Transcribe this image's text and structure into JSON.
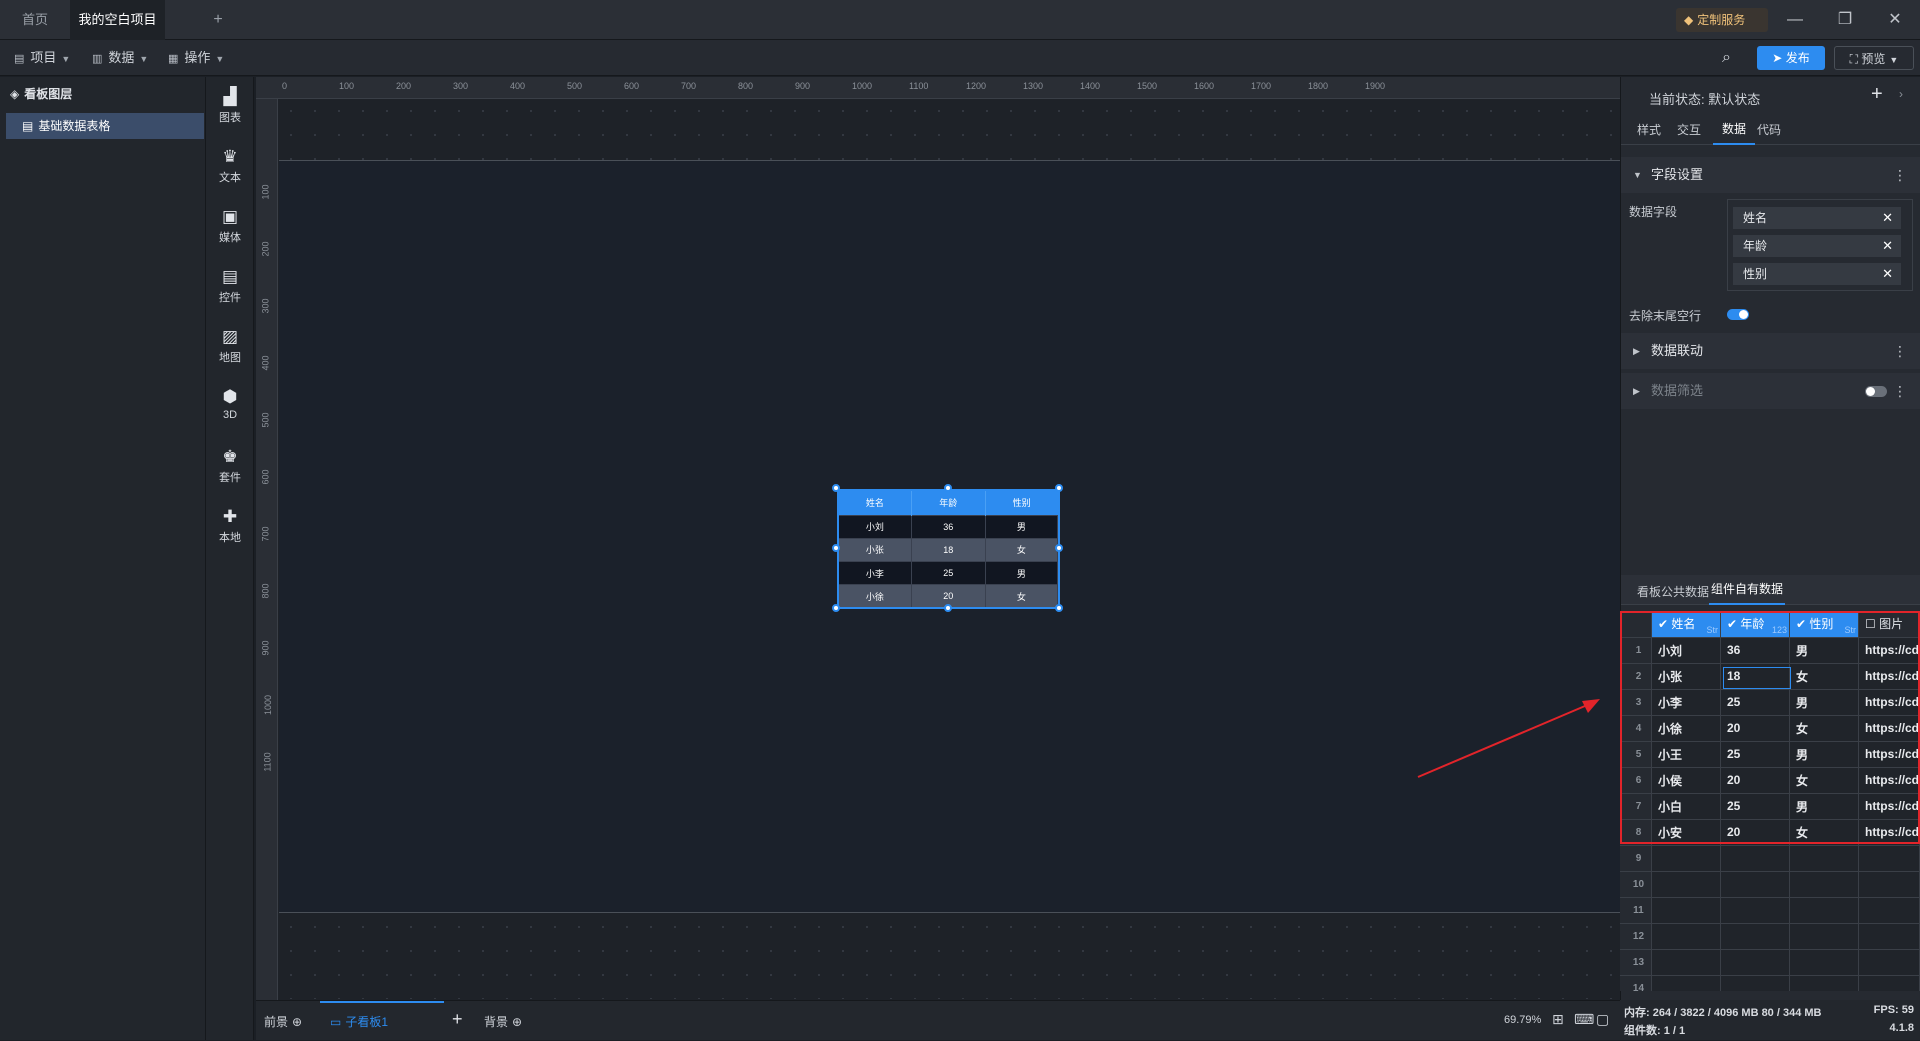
{
  "tabs": {
    "home": "首页",
    "project": "我的空白项目",
    "add": "+"
  },
  "window": {
    "service": "定制服务",
    "minimize": "—",
    "restore": "❐",
    "close": "✕"
  },
  "menu": {
    "project": "项目",
    "data": "数据",
    "operate": "操作",
    "publish": "发布",
    "preview": "预览"
  },
  "layers": {
    "title": "看板图层",
    "items": [
      "基础数据表格"
    ]
  },
  "tools": [
    "图表",
    "文本",
    "媒体",
    "控件",
    "地图",
    "3D",
    "套件",
    "本地"
  ],
  "ruler": {
    "h": [
      "0",
      "100",
      "200",
      "300",
      "400",
      "500",
      "600",
      "700",
      "800",
      "900",
      "1000",
      "1100",
      "1200",
      "1300",
      "1400",
      "1500",
      "1600",
      "1700",
      "1800",
      "1900"
    ],
    "v": [
      "100",
      "200",
      "300",
      "400",
      "500",
      "600",
      "700",
      "800",
      "900",
      "1000",
      "1100"
    ]
  },
  "preview_table": {
    "headers": [
      "姓名",
      "年龄",
      "性别"
    ],
    "rows": [
      [
        "小刘",
        "36",
        "男"
      ],
      [
        "小张",
        "18",
        "女"
      ],
      [
        "小李",
        "25",
        "男"
      ],
      [
        "小徐",
        "20",
        "女"
      ]
    ]
  },
  "bottom": {
    "front": "前景",
    "sub": "子看板1",
    "add": "+",
    "back": "背景",
    "zoom": "69.79%"
  },
  "right": {
    "state_label": "当前状态:",
    "state_value": "默认状态",
    "tabs": [
      "样式",
      "交互",
      "数据",
      "代码"
    ],
    "field_section": "字段设置",
    "data_fields_label": "数据字段",
    "fields": [
      "姓名",
      "年龄",
      "性别"
    ],
    "trim_label": "去除末尾空行",
    "trim_on": true,
    "linkage": "数据联动",
    "filter": "数据筛选",
    "source_tabs": [
      "看板公共数据",
      "组件自有数据"
    ]
  },
  "grid": {
    "columns": [
      {
        "name": "姓名",
        "type": "Str",
        "checked": true
      },
      {
        "name": "年龄",
        "type": "123",
        "checked": true
      },
      {
        "name": "性别",
        "type": "Str",
        "checked": true
      },
      {
        "name": "图片",
        "type": "",
        "checked": false
      }
    ],
    "rows": [
      [
        "1",
        "小刘",
        "36",
        "男",
        "https://cd"
      ],
      [
        "2",
        "小张",
        "18",
        "女",
        "https://cd"
      ],
      [
        "3",
        "小李",
        "25",
        "男",
        "https://cd"
      ],
      [
        "4",
        "小徐",
        "20",
        "女",
        "https://cd"
      ],
      [
        "5",
        "小王",
        "25",
        "男",
        "https://cd"
      ],
      [
        "6",
        "小侯",
        "20",
        "女",
        "https://cd"
      ],
      [
        "7",
        "小白",
        "25",
        "男",
        "https://cd"
      ],
      [
        "8",
        "小安",
        "20",
        "女",
        "https://cd"
      ],
      [
        "9",
        "",
        "",
        "",
        ""
      ],
      [
        "10",
        "",
        "",
        "",
        ""
      ],
      [
        "11",
        "",
        "",
        "",
        ""
      ],
      [
        "12",
        "",
        "",
        "",
        ""
      ],
      [
        "13",
        "",
        "",
        "",
        ""
      ],
      [
        "14",
        "",
        "",
        "",
        ""
      ]
    ]
  },
  "status": {
    "memory": "内存: 264 / 3822 / 4096 MB  80 / 344 MB",
    "fps": "FPS: 59",
    "count": "组件数: 1 / 1",
    "version": "4.1.8"
  },
  "colors": {
    "accent": "#2d8cf0",
    "highlight": "#e2242a"
  }
}
